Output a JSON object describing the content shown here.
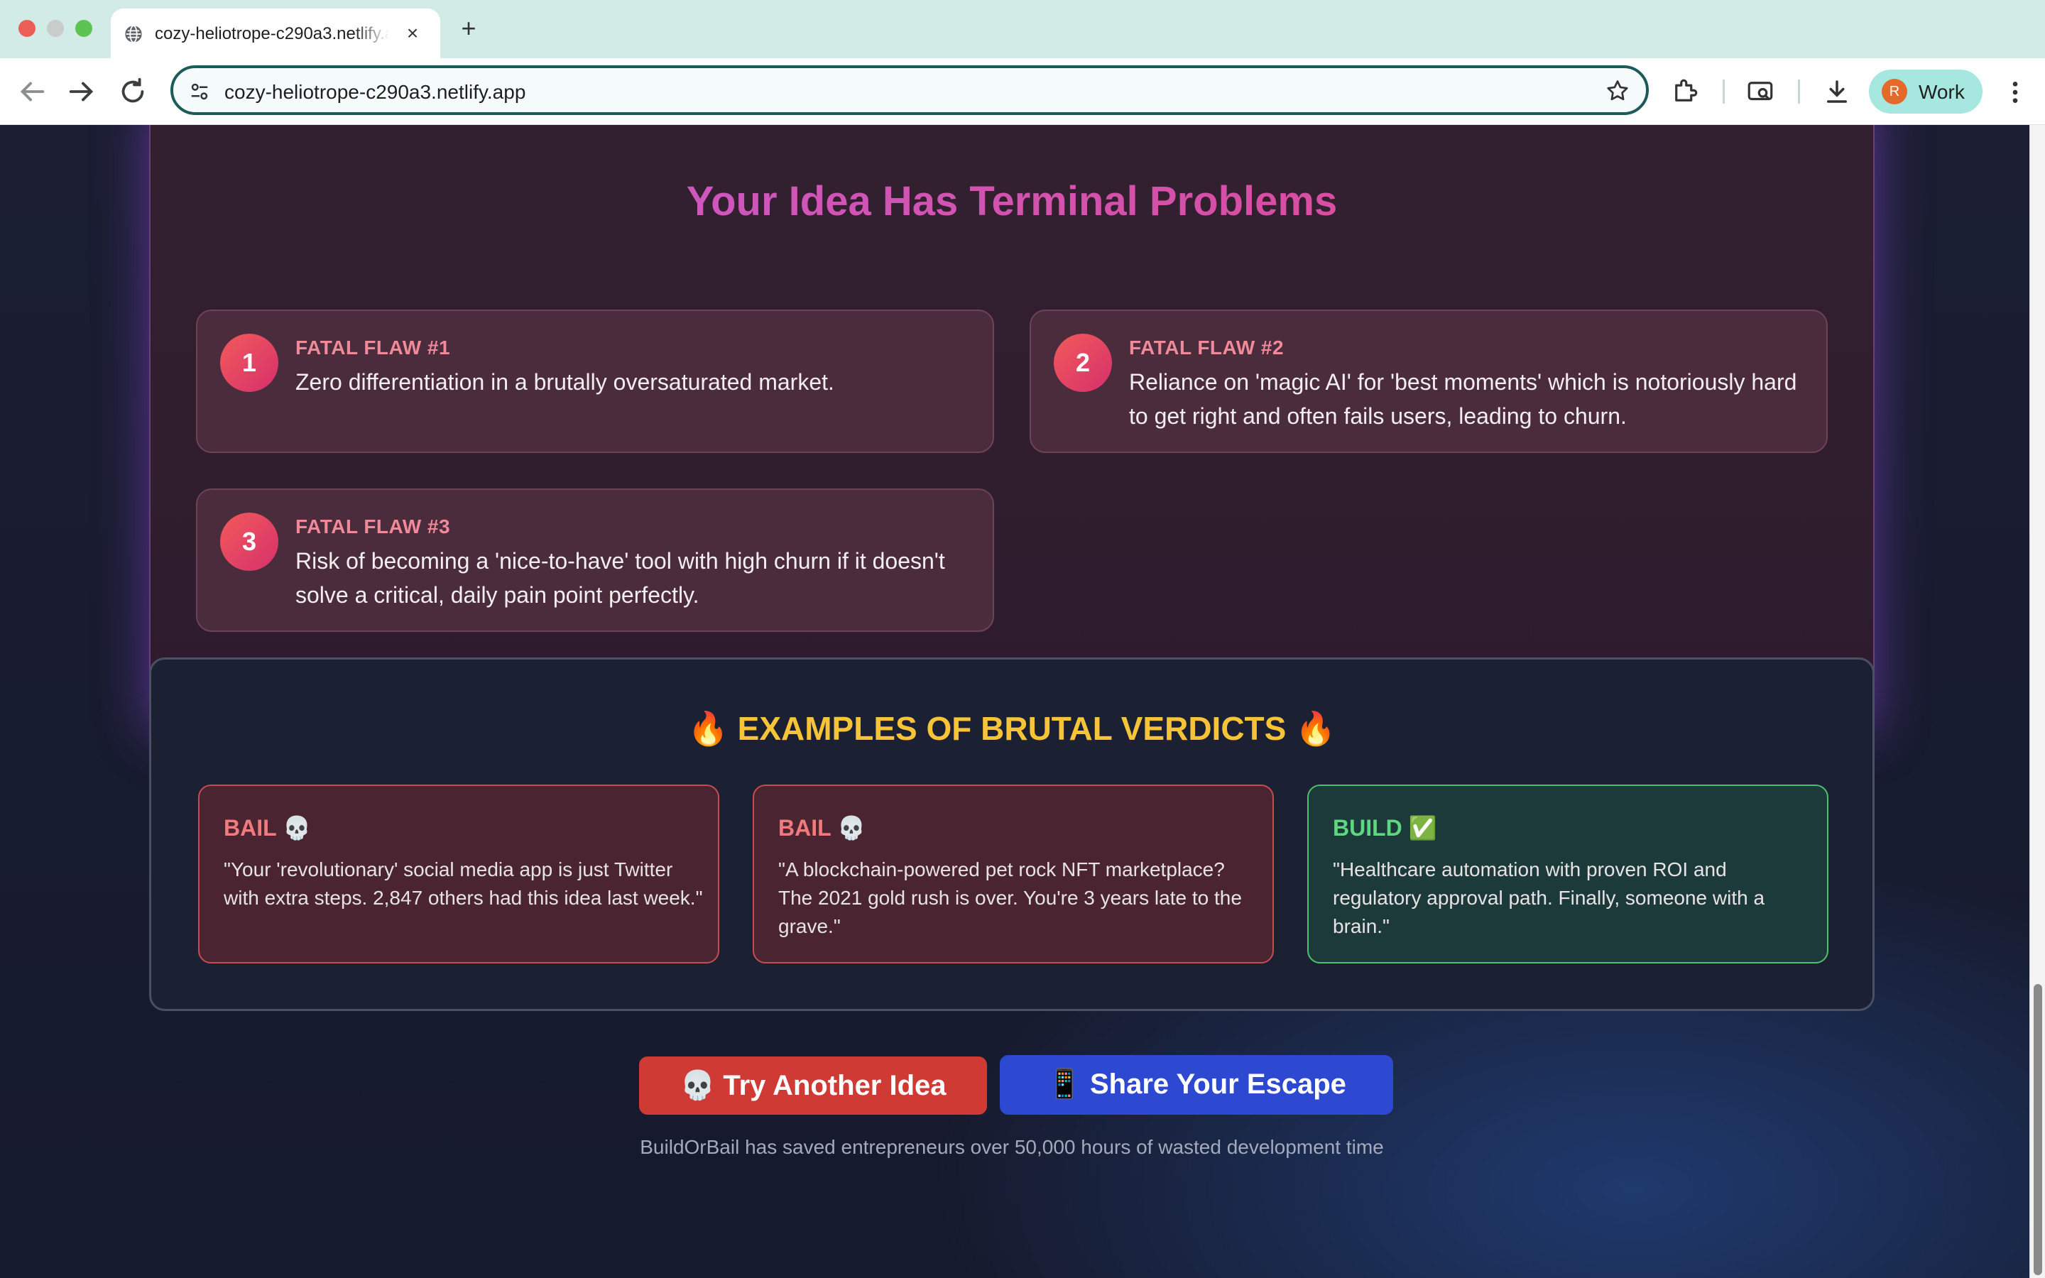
{
  "browser": {
    "tab_title": "cozy-heliotrope-c290a3.netlify.app",
    "url": "cozy-heliotrope-c290a3.netlify.app",
    "profile_initial": "R",
    "profile_label": "Work"
  },
  "problems": {
    "title": "Your Idea Has Terminal Problems",
    "flaws": [
      {
        "number": "1",
        "label": "FATAL FLAW #1",
        "text": "Zero differentiation in a brutally oversaturated market."
      },
      {
        "number": "2",
        "label": "FATAL FLAW #2",
        "text": "Reliance on 'magic AI' for 'best moments' which is notoriously hard to get right and often fails users, leading to churn."
      },
      {
        "number": "3",
        "label": "FATAL FLAW #3",
        "text": "Risk of becoming a 'nice-to-have' tool with high churn if it doesn't solve a critical, daily pain point perfectly."
      }
    ]
  },
  "examples": {
    "title": "🔥 EXAMPLES OF BRUTAL VERDICTS 🔥",
    "verdicts": [
      {
        "type": "bail",
        "label": "BAIL 💀",
        "text": "\"Your 'revolutionary' social media app is just Twitter with extra steps. 2,847 others had this idea last week.\""
      },
      {
        "type": "bail",
        "label": "BAIL 💀",
        "text": "\"A blockchain-powered pet rock NFT marketplace? The 2021 gold rush is over. You're 3 years late to the grave.\""
      },
      {
        "type": "build",
        "label": "BUILD ✅",
        "text": "\"Healthcare automation with proven ROI and regulatory approval path. Finally, someone with a brain.\""
      }
    ]
  },
  "actions": {
    "try_label": "💀 Try Another Idea",
    "share_label": "📱 Share Your Escape"
  },
  "footer_note": "BuildOrBail has saved entrepreneurs over 50,000 hours of wasted development time",
  "colors": {
    "accent_pink": "#e0468a",
    "bail_red": "#cf3a35",
    "share_blue": "#2d48d1",
    "build_green": "#4cc06e",
    "verdict_gold": "#f7c437"
  }
}
